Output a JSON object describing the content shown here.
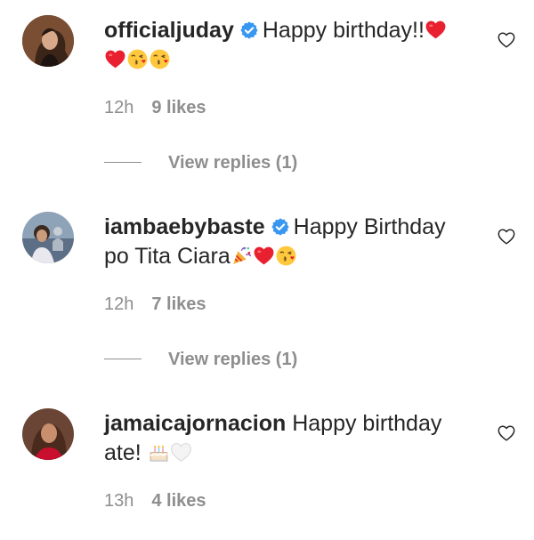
{
  "comments": [
    {
      "username": "officialjuday",
      "verified": true,
      "text_line1": "Happy birthday!!",
      "emojis_line1": [
        "red-heart"
      ],
      "emojis_line2": [
        "red-heart",
        "face-blowing-kiss",
        "face-blowing-kiss"
      ],
      "time": "12h",
      "likes": "9 likes",
      "replies": "View replies (1)"
    },
    {
      "username": "iambaebybaste",
      "verified": true,
      "text_line1": "Happy Birthday",
      "text_line2": "po Tita Ciara",
      "emojis_line2": [
        "party-popper",
        "red-heart",
        "face-blowing-kiss"
      ],
      "time": "12h",
      "likes": "7 likes",
      "replies": "View replies (1)"
    },
    {
      "username": "jamaicajornacion",
      "verified": false,
      "text_line1": "Happy birthday",
      "text_line2": "ate!",
      "emojis_line2": [
        "birthday-cake",
        "white-heart"
      ],
      "time": "13h",
      "likes": "4 likes"
    }
  ],
  "colors": {
    "text": "#262626",
    "muted": "#8e8e8e",
    "verified": "#3897f0",
    "heart": "#e8202f",
    "kiss_face": "#ffc83d"
  }
}
